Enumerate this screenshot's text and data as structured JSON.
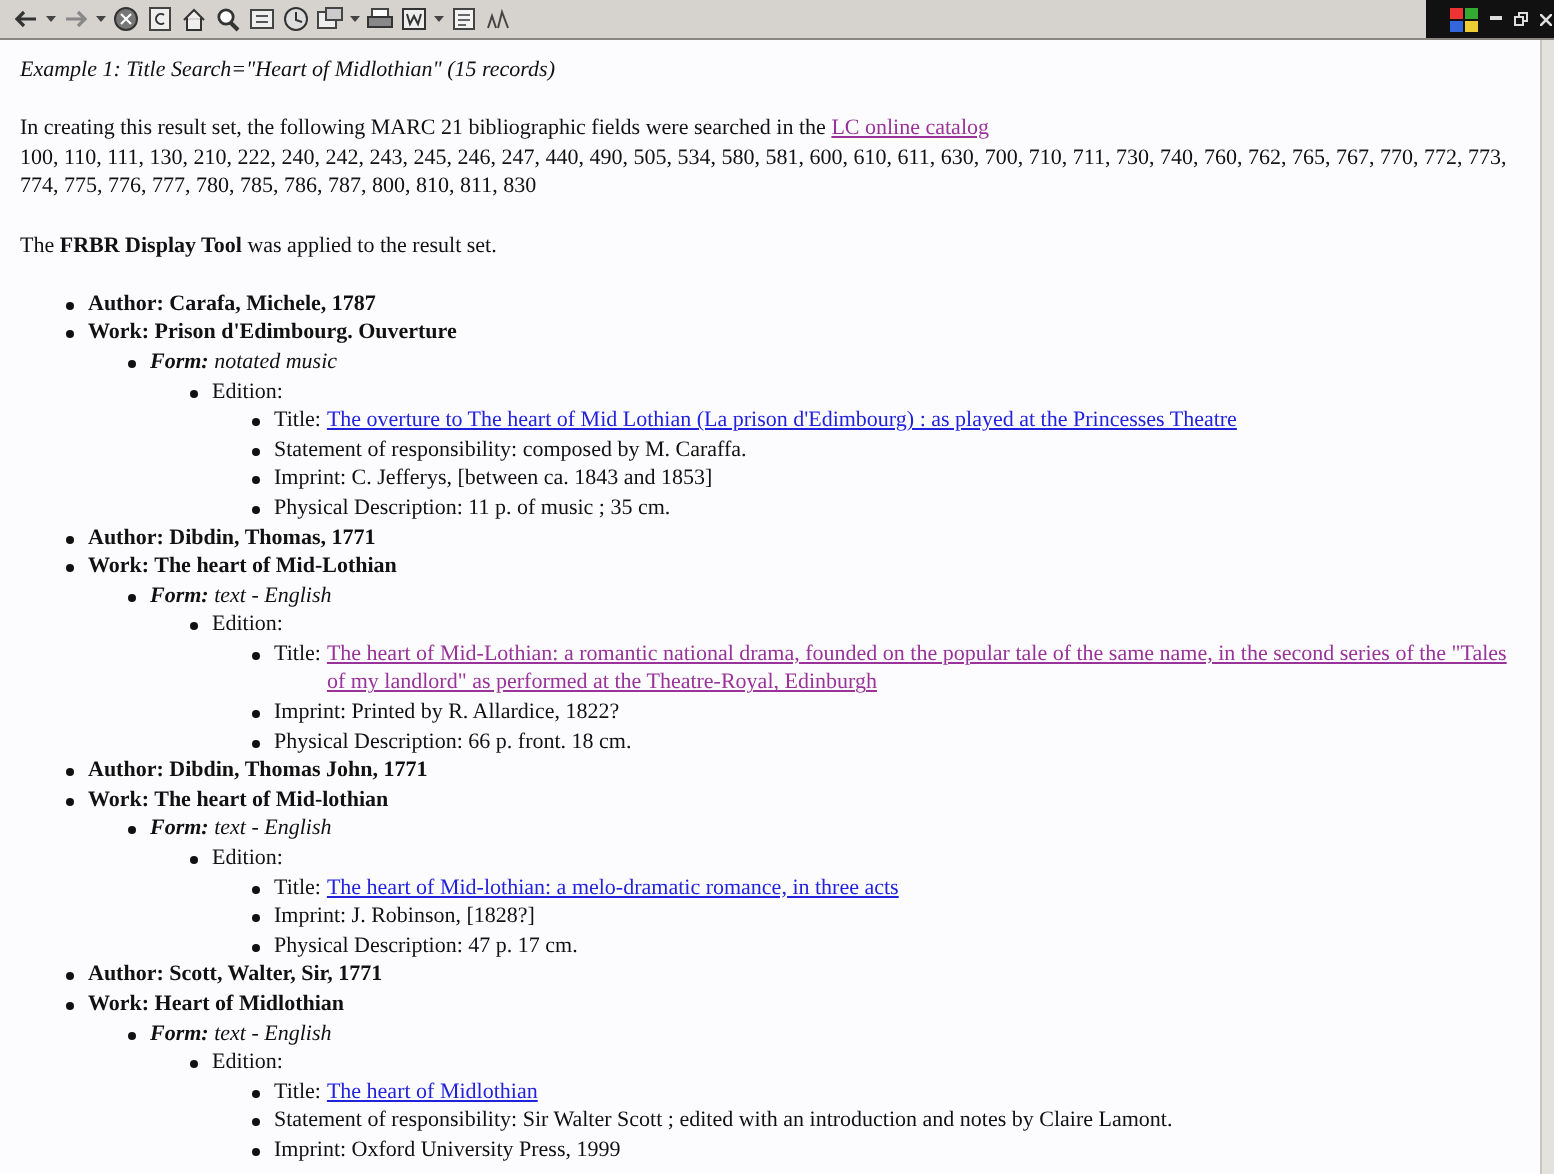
{
  "heading": "Example 1: Title Search=\"Heart of Midlothian\" (15 records)",
  "intro": {
    "text": "In creating this result set, the following MARC 21 bibliographic fields were searched in the",
    "link": "LC online catalog",
    "link_visited": true,
    "fields": "100, 110, 111, 130, 210, 222, 240, 242, 243, 245, 246, 247, 440, 490, 505, 534, 580, 581, 600, 610, 611, 630, 700, 710, 711, 730, 740, 760, 762, 765, 767, 770, 772, 773, 774, 775, 776, 777, 780, 785, 786, 787, 800, 810, 811, 830"
  },
  "tool_note": "The **FRBR Display Tool** was applied to the result set.",
  "results": [
    {
      "kind": "heading",
      "text": "Author: Carafa, Michele, 1787"
    },
    {
      "kind": "heading",
      "text": "Work: Prison d'Edimbourg. Ouverture",
      "children": [
        {
          "kind": "form",
          "text": "**Form:** notated music",
          "children": [
            {
              "kind": "field",
              "text": "Edition:",
              "children": [
                {
                  "kind": "title",
                  "label": "Title:",
                  "link": "The overture to The heart of Mid Lothian (La prison d'Edimbourg) : as played at the Princesses Theatre",
                  "visited": false
                },
                {
                  "kind": "field",
                  "text": "Statement of responsibility: composed by M. Caraffa."
                },
                {
                  "kind": "field",
                  "text": "Imprint: C. Jefferys, [between ca. 1843 and 1853]"
                },
                {
                  "kind": "field",
                  "text": "Physical Description: 11 p. of music ; 35 cm."
                }
              ]
            }
          ]
        }
      ]
    },
    {
      "kind": "heading",
      "text": "Author: Dibdin, Thomas, 1771"
    },
    {
      "kind": "heading",
      "text": "Work: The heart of Mid-Lothian",
      "children": [
        {
          "kind": "form",
          "text": "**Form:** text - English",
          "children": [
            {
              "kind": "field",
              "text": "Edition:",
              "children": [
                {
                  "kind": "title",
                  "label": "Title:",
                  "link": "The heart of Mid-Lothian: a romantic national drama, founded on the popular tale of the same name, in the second series of the \"Tales of my landlord\" as performed at the Theatre-Royal, Edinburgh",
                  "visited": true
                },
                {
                  "kind": "field",
                  "text": "Imprint: Printed by R. Allardice, 1822?"
                },
                {
                  "kind": "field",
                  "text": "Physical Description: 66 p. front. 18 cm."
                }
              ]
            }
          ]
        }
      ]
    },
    {
      "kind": "heading",
      "text": "Author: Dibdin, Thomas John, 1771"
    },
    {
      "kind": "heading",
      "text": "Work: The heart of Mid-lothian",
      "children": [
        {
          "kind": "form",
          "text": "**Form:** text - English",
          "children": [
            {
              "kind": "field",
              "text": "Edition:",
              "children": [
                {
                  "kind": "title",
                  "label": "Title:",
                  "link": "The heart of Mid-lothian: a melo-dramatic romance, in three acts",
                  "visited": false
                },
                {
                  "kind": "field",
                  "text": "Imprint: J. Robinson, [1828?]"
                },
                {
                  "kind": "field",
                  "text": "Physical Description: 47 p. 17 cm."
                }
              ]
            }
          ]
        }
      ]
    },
    {
      "kind": "heading",
      "text": "Author: Scott, Walter, Sir, 1771"
    },
    {
      "kind": "heading",
      "text": "Work: Heart of Midlothian",
      "children": [
        {
          "kind": "form",
          "text": "**Form:** text - English",
          "children": [
            {
              "kind": "field",
              "text": "Edition:",
              "children": [
                {
                  "kind": "title",
                  "label": "Title:",
                  "link": "The heart of Midlothian",
                  "visited": false
                },
                {
                  "kind": "field",
                  "text": "Statement of responsibility: Sir Walter Scott ; edited with an introduction and notes by Claire Lamont."
                },
                {
                  "kind": "field",
                  "text": "Imprint: Oxford University Press, 1999"
                }
              ]
            }
          ]
        }
      ]
    }
  ]
}
